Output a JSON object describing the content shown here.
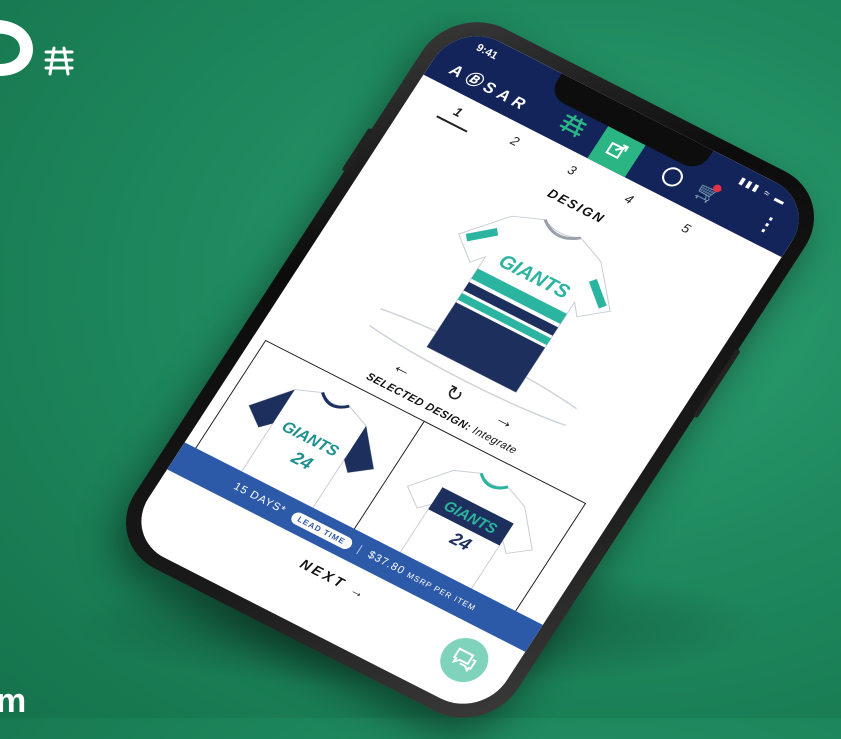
{
  "page": {
    "background_color": "#1f8a5f",
    "bottom_text": "m"
  },
  "status_bar": {
    "time": "9:41",
    "icons": "▮▮▮ ≈ ▬"
  },
  "app": {
    "brand": "AⒷSAR",
    "icons": [
      "share-icon",
      "account-icon",
      "cart-icon",
      "menu-icon"
    ],
    "accent_color": "#2bb585",
    "nav_color": "#13245a"
  },
  "steps": {
    "items": [
      "1",
      "2",
      "3",
      "4",
      "5"
    ],
    "active": "1",
    "title": "DESIGN"
  },
  "jersey": {
    "text": "GIANTS",
    "colors": {
      "primary": "#ffffff",
      "stripe": "#2bb5a0",
      "navy": "#1d2f5c"
    }
  },
  "carousel": {
    "prev": "←",
    "rotate": "↻",
    "next": "→"
  },
  "selected_design": {
    "label": "SELECTED DESIGN:",
    "value": "Integrate"
  },
  "cards": [
    {
      "text": "GIANTS",
      "number": "24"
    },
    {
      "text": "GIANTS",
      "number": "24"
    }
  ],
  "lead_time": {
    "days": "15 DAYS*",
    "badge": "LEAD TIME",
    "price": "$37.80",
    "price_suffix": "MSRP PER ITEM"
  },
  "next_button": {
    "label": "NEXT →"
  }
}
